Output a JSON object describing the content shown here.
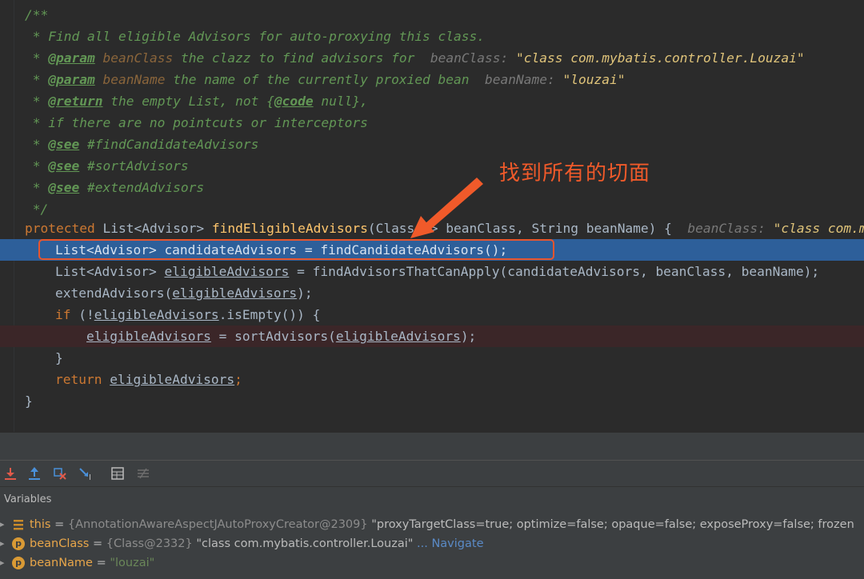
{
  "editor": {
    "javadoc": {
      "open": "/**",
      "line1": " * Find all eligible Advisors for auto-proxying this class.",
      "param1_tag": "@param",
      "param1_name": "beanClass",
      "param1_desc": " the clazz to find advisors for",
      "param1_hint_label": "beanClass:",
      "param1_hint_value": "\"class com.mybatis.controller.Louzai\"",
      "param2_tag": "@param",
      "param2_name": "beanName",
      "param2_desc": " the name of the currently proxied bean",
      "param2_hint_label": "beanName:",
      "param2_hint_value": "\"louzai\"",
      "return_tag": "@return",
      "return_desc": " the empty List, not {",
      "return_code_tag": "@code",
      "return_desc2": " null},",
      "line_pointcuts": " * if there are no pointcuts or interceptors",
      "see_tag": "@see",
      "see1": " #findCandidateAdvisors",
      "see2": " #sortAdvisors",
      "see3": " #extendAdvisors",
      "close": " */"
    },
    "method_sig": {
      "modifier": "protected",
      "ret": " List<Advisor> ",
      "name": "findEligibleAdvisors",
      "params": "(Class<?> beanClass, String beanName) {",
      "hint_label": "beanClass:",
      "hint_value": "\"class com.m"
    },
    "lines": {
      "l1": "List<Advisor> candidateAdvisors = findCandidateAdvisors();",
      "l2_a": "List<Advisor> ",
      "l2_var": "eligibleAdvisors",
      "l2_b": " = findAdvisorsThatCanApply(candidateAdvisors, beanClass, beanName);",
      "l3_a": "extendAdvisors(",
      "l3_var": "eligibleAdvisors",
      "l3_b": ");",
      "l4_kw": "if",
      "l4_a": " (!",
      "l4_var": "eligibleAdvisors",
      "l4_b": ".isEmpty()) {",
      "l5_var1": "eligibleAdvisors",
      "l5_a": " = sortAdvisors(",
      "l5_var2": "eligibleAdvisors",
      "l5_b": ");",
      "l6": "}",
      "l7_kw": "return",
      "l7_var": "eligibleAdvisors",
      "l7_b": ";",
      "l8": "}"
    },
    "annotation": "找到所有的切面"
  },
  "debugger": {
    "panel_title": "Variables",
    "toolbar_icons": [
      "step-into-icon",
      "step-out-icon",
      "run-to-cursor-icon",
      "force-step-icon",
      "evaluate-icon",
      "trace-icon"
    ],
    "variables": [
      {
        "name": "this",
        "ref": "{AnnotationAwareAspectJAutoProxyCreator@2309}",
        "value": " \"proxyTargetClass=true; optimize=false; opaque=false; exposeProxy=false; frozen"
      },
      {
        "name": "beanClass",
        "ref": "{Class@2332}",
        "value": " \"class com.mybatis.controller.Louzai\"",
        "nav": "... Navigate"
      },
      {
        "name": "beanName",
        "ref": "",
        "value": "\"louzai\""
      }
    ],
    "colors": {
      "accent": "#2d5f9a",
      "annotation": "#f05a2a",
      "param_icon": "#d99a35",
      "field_icon": "#c98a2a"
    }
  }
}
